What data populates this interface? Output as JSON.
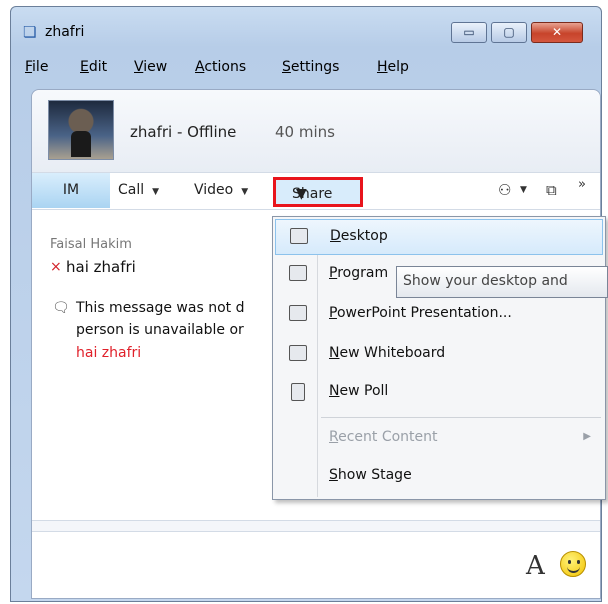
{
  "window": {
    "title": "zhafri",
    "buttons": {
      "minimize": "▭",
      "maximize": "▢",
      "close": "✕"
    }
  },
  "menubar": {
    "items": [
      "File",
      "Edit",
      "View",
      "Actions",
      "Settings",
      "Help"
    ]
  },
  "contact": {
    "name": "zhafri - Offline",
    "since": "40 mins"
  },
  "toolbar": {
    "tabs": {
      "im": "IM",
      "call": "Call",
      "video": "Video",
      "share": "Share"
    },
    "caret": "▼",
    "icons": [
      "people-options-icon",
      "attachment-icon",
      "overflow-icon"
    ]
  },
  "conversation": {
    "sender": "Faisal Hakim",
    "message": "hai zhafri",
    "failed_prefix": "×",
    "failure_lines": [
      "This message was not d",
      "person is unavailable or"
    ],
    "failed_text": "hai zhafri"
  },
  "share_menu": {
    "items": [
      {
        "label": "Desktop",
        "icon": "desktop-icon",
        "highlighted": true,
        "enabled": true
      },
      {
        "label": "Program",
        "icon": "program-icon",
        "highlighted": false,
        "enabled": true
      },
      {
        "label": "PowerPoint Presentation...",
        "icon": "powerpoint-icon",
        "highlighted": false,
        "enabled": true
      },
      {
        "label": "New Whiteboard",
        "icon": "whiteboard-icon",
        "highlighted": false,
        "enabled": true
      },
      {
        "label": "New Poll",
        "icon": "poll-icon",
        "highlighted": false,
        "enabled": true
      },
      {
        "label": "Recent Content",
        "icon": "",
        "highlighted": false,
        "enabled": false
      },
      {
        "label": "Show Stage",
        "icon": "",
        "highlighted": false,
        "enabled": true
      }
    ]
  },
  "tooltip": {
    "text": "Show your desktop and"
  },
  "compose": {
    "font_glyph": "A"
  },
  "colors": {
    "highlight_border": "#e8141c",
    "failed_text": "#e0202a"
  }
}
